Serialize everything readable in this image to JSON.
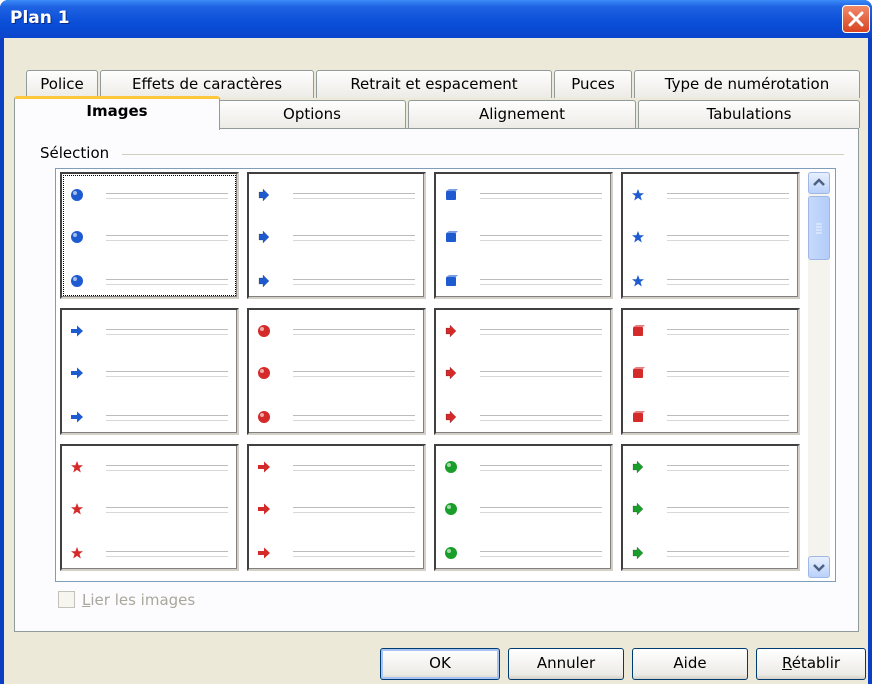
{
  "window": {
    "title": "Plan 1"
  },
  "tabs": {
    "row1": [
      "Police",
      "Effets de caractères",
      "Retrait et espacement",
      "Puces",
      "Type de numérotation"
    ],
    "row2": [
      "Images",
      "Options",
      "Alignement",
      "Tabulations"
    ],
    "active": "Images"
  },
  "selection": {
    "label": "Sélection",
    "grid": [
      [
        {
          "shape": "ball",
          "color": "blue"
        },
        {
          "shape": "arrow-dark",
          "color": "blue"
        },
        {
          "shape": "cube",
          "color": "blue"
        },
        {
          "shape": "star",
          "color": "blue"
        }
      ],
      [
        {
          "shape": "arrow",
          "color": "blue"
        },
        {
          "shape": "ball",
          "color": "red"
        },
        {
          "shape": "arrow-dark",
          "color": "red"
        },
        {
          "shape": "cube",
          "color": "red"
        }
      ],
      [
        {
          "shape": "star",
          "color": "red"
        },
        {
          "shape": "arrow",
          "color": "red"
        },
        {
          "shape": "ball",
          "color": "green"
        },
        {
          "shape": "arrow-dark",
          "color": "green"
        }
      ]
    ]
  },
  "link_images": {
    "label_u": "L",
    "label_rest": "ier les images",
    "checked": false,
    "enabled": false
  },
  "buttons": {
    "ok": "OK",
    "cancel": "Annuler",
    "help": "Aide",
    "reset_u": "R",
    "reset_rest": "établir"
  },
  "colors": {
    "blue": "#1e5bd0",
    "red": "#d42a2a",
    "green": "#1a9e2a",
    "title_bar": "#0a4ed8"
  }
}
